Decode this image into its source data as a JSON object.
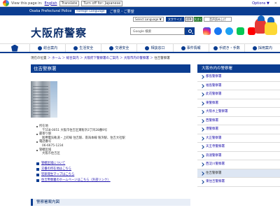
{
  "gtbar": {
    "view_label": "View this page in:",
    "language": "English",
    "translate_label": "Translate",
    "turn_off_label": "Turn off for: Japanese",
    "options_label": "Options ▼"
  },
  "topbar": {
    "police": "Osaka Prefectural Police",
    "foreign_language": "Foreign Language",
    "easy_japanese": "ご意見・ご要望"
  },
  "header": {
    "site_title": "大阪府警察",
    "select_language": "Select Language ▼",
    "font_size_label": "文字サイズ",
    "font_std": "標準",
    "font_big": "大きく",
    "ddl_label": "音声読み上げ",
    "search_placeholder": "Google 検索"
  },
  "nav": {
    "items": [
      "総合案内",
      "生活安全",
      "交通安全",
      "相談窓口",
      "事件情報",
      "手続き・手数",
      "採用案内"
    ]
  },
  "breadcrumb": {
    "items": [
      "現在の位置",
      "ホーム",
      "総合案内",
      "大阪府下警察署のご案内",
      "大阪市内の警察署"
    ],
    "current": "住吉警察署"
  },
  "main": {
    "title": "住吉警察署",
    "info": {
      "address_label": "所在地",
      "address": "〒558-0051 大阪市住吉区東粉浜3丁目28番9号",
      "access_label": "最寄り駅",
      "access": "阪堺電気軌道・上町線 住吉駅、南海本線 粉浜駅、住吉大社駅",
      "phone_label": "電話番号",
      "phone": "06-6675-1234",
      "area_label": "管轄区域",
      "area": "大阪市住吉区"
    },
    "links": [
      "管轄区域について",
      "交番の所在地はこちら",
      "犯罪発生マップはこちら",
      "住吉警察署のホームページはこちら（外部リンク）"
    ],
    "section_title": "警察署案内図"
  },
  "side": {
    "title": "大阪市内の警察署",
    "items": [
      "都島警察署",
      "福島警察署",
      "此花警察署",
      "東警察署",
      "大阪水上警察署",
      "西警察署",
      "港警察署",
      "大正警察署",
      "天王寺警察署",
      "浪速警察署",
      "西淀川警察署",
      "住吉警察署",
      "東住吉警察署"
    ],
    "active_index": 11
  }
}
